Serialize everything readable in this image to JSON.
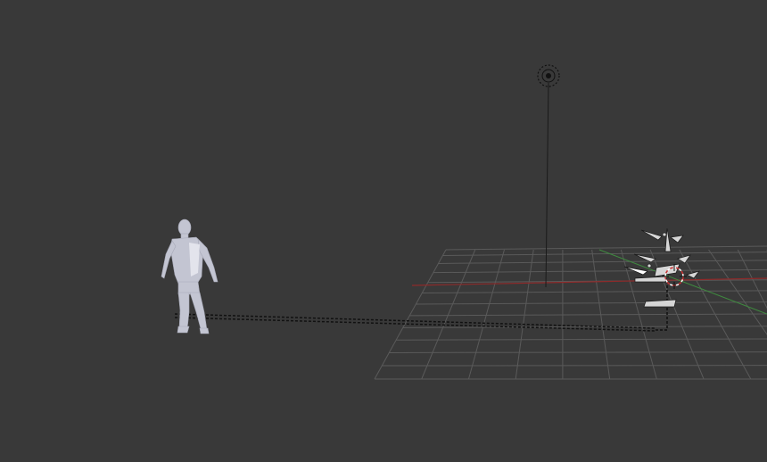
{
  "viewport": {
    "background": "#393939",
    "grid_color": "#5a5a5a",
    "x_axis_color": "#8e2a2a",
    "y_axis_color": "#3f8a3f"
  },
  "objects": [
    {
      "name": "human-mesh",
      "icon": "human-figure",
      "color": "#c3c5d2"
    },
    {
      "name": "lamp",
      "icon": "lamp-icon"
    },
    {
      "name": "armature-bones",
      "icon": "bone-icon",
      "color": "#cfcfcf"
    },
    {
      "name": "3d-cursor",
      "icon": "crosshair-icon",
      "color": "#c83232"
    }
  ]
}
